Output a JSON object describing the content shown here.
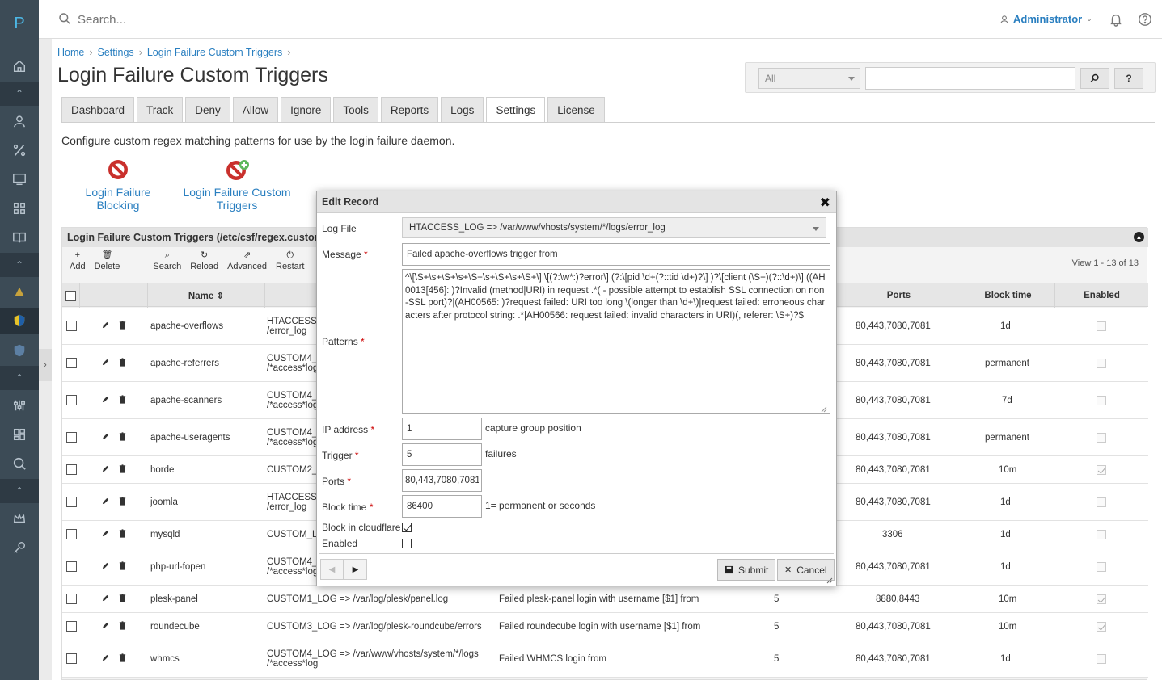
{
  "topbar": {
    "search_placeholder": "Search...",
    "user": "Administrator"
  },
  "sidebar": {
    "logo": "P",
    "icons": [
      "home-icon",
      "user-icon",
      "percent-icon",
      "monitor-icon",
      "grid-icon",
      "book-icon",
      "vpn-icon",
      "shield-icon",
      "cube-icon",
      "sliders-icon",
      "dashboard-icon",
      "search-icon",
      "crown-icon",
      "key-icon"
    ]
  },
  "breadcrumb": [
    "Home",
    "Settings",
    "Login Failure Custom Triggers"
  ],
  "page_title": "Login Failure Custom Triggers",
  "filter": {
    "select_value": "All",
    "search_button": "⌕",
    "help_button": "?"
  },
  "tabs": [
    "Dashboard",
    "Track",
    "Deny",
    "Allow",
    "Ignore",
    "Tools",
    "Reports",
    "Logs",
    "Settings",
    "License"
  ],
  "description": "Configure custom regex matching patterns for use by the login failure daemon.",
  "big_buttons": [
    {
      "label_1": "Login Failure",
      "label_2": "Blocking"
    },
    {
      "label_1": "Login Failure Custom",
      "label_2": "Triggers"
    }
  ],
  "panel": {
    "title": "Login Failure Custom Triggers (/etc/csf/regex.custom.",
    "toolbar": [
      "Add",
      "Delete",
      "Search",
      "Reload",
      "Advanced",
      "Restart"
    ],
    "view_info": "View 1 - 13 of 13",
    "columns": {
      "name": "Name ⇕",
      "ports": "Ports",
      "block_time": "Block time",
      "enabled": "Enabled"
    }
  },
  "rows": [
    {
      "name": "apache-overflows",
      "log1": "HTACCESS_L",
      "log2": "/error_log",
      "message": "",
      "trigger": "",
      "ports": "80,443,7080,7081",
      "block": "1d",
      "enabled": false
    },
    {
      "name": "apache-referrers",
      "log1": "CUSTOM4_L",
      "log2": "/*access*log",
      "message": "",
      "trigger": "",
      "ports": "80,443,7080,7081",
      "block": "permanent",
      "enabled": false
    },
    {
      "name": "apache-scanners",
      "log1": "CUSTOM4_L",
      "log2": "/*access*log",
      "message": "",
      "trigger": "",
      "ports": "80,443,7080,7081",
      "block": "7d",
      "enabled": false
    },
    {
      "name": "apache-useragents",
      "log1": "CUSTOM4_L",
      "log2": "/*access*log",
      "message": "",
      "trigger": "",
      "ports": "80,443,7080,7081",
      "block": "permanent",
      "enabled": false
    },
    {
      "name": "horde",
      "log1": "CUSTOM2_L",
      "log2": "",
      "message": "",
      "trigger": "",
      "ports": "80,443,7080,7081",
      "block": "10m",
      "enabled": true
    },
    {
      "name": "joomla",
      "log1": "HTACCESS_",
      "log2": "/error_log",
      "message": "",
      "trigger": "",
      "ports": "80,443,7080,7081",
      "block": "1d",
      "enabled": false
    },
    {
      "name": "mysqld",
      "log1": "CUSTOM_LO",
      "log2": "",
      "message": "",
      "trigger": "",
      "ports": "3306",
      "block": "1d",
      "enabled": false
    },
    {
      "name": "php-url-fopen",
      "log1": "CUSTOM4_L",
      "log2": "/*access*log",
      "message": "",
      "trigger": "",
      "ports": "80,443,7080,7081",
      "block": "1d",
      "enabled": false
    },
    {
      "name": "plesk-panel",
      "log1": "CUSTOM1_LOG => /var/log/plesk/panel.log",
      "log2": "",
      "message": "Failed plesk-panel login with username [$1] from",
      "trigger": "5",
      "ports": "8880,8443",
      "block": "10m",
      "enabled": true
    },
    {
      "name": "roundecube",
      "log1": "CUSTOM3_LOG => /var/log/plesk-roundcube/errors",
      "log2": "",
      "message": "Failed roundecube login with username [$1] from",
      "trigger": "5",
      "ports": "80,443,7080,7081",
      "block": "10m",
      "enabled": true
    },
    {
      "name": "whmcs",
      "log1": "CUSTOM4_LOG => /var/www/vhosts/system/*/logs",
      "log2": "/*access*log",
      "message": "Failed WHMCS login from",
      "trigger": "5",
      "ports": "80,443,7080,7081",
      "block": "1d",
      "enabled": false
    }
  ],
  "dialog": {
    "title": "Edit Record",
    "close": "✖",
    "labels": {
      "log_file": "Log File",
      "message": "Message",
      "patterns": "Patterns",
      "ip": "IP address",
      "trigger": "Trigger",
      "ports": "Ports",
      "block_time": "Block time",
      "cloudflare": "Block in cloudflare",
      "enabled": "Enabled"
    },
    "required_mark": "*",
    "log_file_value": "HTACCESS_LOG => /var/www/vhosts/system/*/logs/error_log",
    "message_value": "Failed apache-overflows trigger from",
    "patterns_value": "^\\[\\S+\\s+\\S+\\s+\\S+\\s+\\S+\\s+\\S+\\] \\[(?:\\w*:)?error\\] (?:\\[pid \\d+(?::tid \\d+)?\\] )?\\[client (\\S+)(?::\\d+)\\] ((AH0013[456]: )?Invalid (method|URI) in request .*( - possible attempt to establish SSL connection on non-SSL port)?|(AH00565: )?request failed: URI too long \\(longer than \\d+\\)|request failed: erroneous characters after protocol string: .*|AH00566: request failed: invalid characters in URI)(, referer: \\S+)?$",
    "ip_value": "1",
    "ip_hint": "capture group position",
    "trigger_value": "5",
    "trigger_hint": "failures",
    "ports_value": "80,443,7080,7081",
    "block_value": "86400",
    "block_hint": "1= permanent or seconds",
    "cloudflare_checked": true,
    "enabled_checked": false,
    "submit": "Submit",
    "cancel": "Cancel"
  }
}
